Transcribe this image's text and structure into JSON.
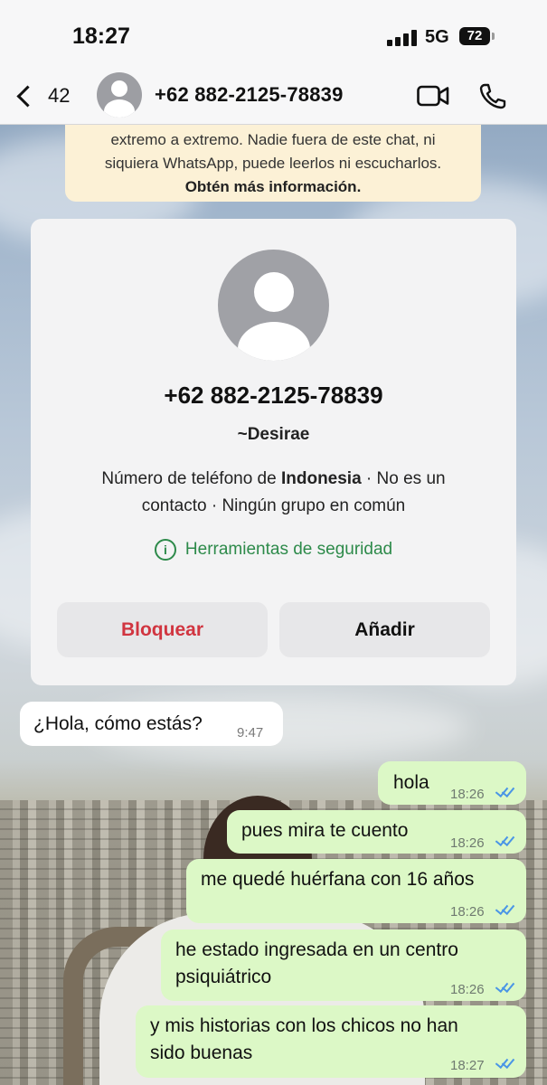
{
  "status_bar": {
    "time": "18:27",
    "network": "5G",
    "battery": "72"
  },
  "header": {
    "back_count": "42",
    "contact_name": "+62 882-2125-78839"
  },
  "encryption_banner": {
    "line1": "extremo a extremo. Nadie fuera de este chat, ni",
    "line2": "siquiera WhatsApp, puede leerlos ni escucharlos.",
    "link": "Obtén más información."
  },
  "contact_card": {
    "phone": "+62 882-2125-78839",
    "alias": "~Desirae",
    "info_prefix": "Número de teléfono de ",
    "country": "Indonesia",
    "info_suffix": " · No es un",
    "info_line2": "contacto · Ningún grupo en común",
    "safety_tools": "Herramientas de seguridad",
    "block_label": "Bloquear",
    "add_label": "Añadir"
  },
  "messages": [
    {
      "direction": "incoming",
      "lines": [
        "¿Hola, cómo estás?"
      ],
      "time": "9:47"
    },
    {
      "direction": "outgoing",
      "lines": [
        "hola"
      ],
      "time": "18:26",
      "status": "read"
    },
    {
      "direction": "outgoing",
      "lines": [
        "pues mira te cuento"
      ],
      "time": "18:26",
      "status": "read"
    },
    {
      "direction": "outgoing",
      "lines": [
        "me quedé huérfana con 16 años"
      ],
      "time": "18:26",
      "status": "read"
    },
    {
      "direction": "outgoing",
      "lines": [
        "he estado ingresada en un centro",
        "psiquiátrico"
      ],
      "time": "18:26",
      "status": "read"
    },
    {
      "direction": "outgoing",
      "lines": [
        "y mis historias con los chicos no han",
        "sido buenas"
      ],
      "time": "18:27",
      "status": "read"
    }
  ],
  "colors": {
    "outgoing_bubble": "#dcf8c6",
    "incoming_bubble": "#ffffff",
    "read_ticks": "#4a95e6",
    "safety_green": "#2d8a4a",
    "block_red": "#d13540",
    "banner": "#fcf1d6"
  },
  "icons": [
    "back-chevron-icon",
    "avatar-icon",
    "video-call-icon",
    "phone-call-icon",
    "info-icon",
    "double-check-icon"
  ]
}
